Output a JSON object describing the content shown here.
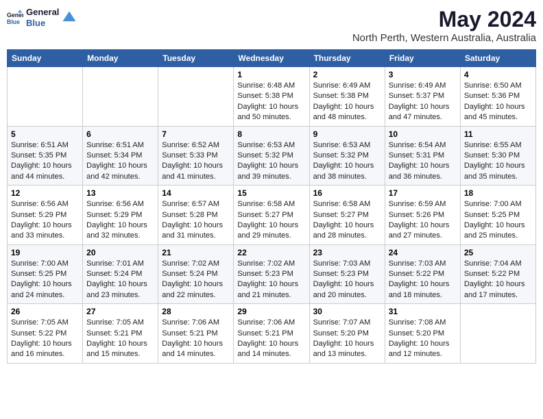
{
  "logo": {
    "line1": "General",
    "line2": "Blue"
  },
  "title": "May 2024",
  "subtitle": "North Perth, Western Australia, Australia",
  "days_header": [
    "Sunday",
    "Monday",
    "Tuesday",
    "Wednesday",
    "Thursday",
    "Friday",
    "Saturday"
  ],
  "weeks": [
    [
      {
        "day": "",
        "info": ""
      },
      {
        "day": "",
        "info": ""
      },
      {
        "day": "",
        "info": ""
      },
      {
        "day": "1",
        "info": "Sunrise: 6:48 AM\nSunset: 5:38 PM\nDaylight: 10 hours\nand 50 minutes."
      },
      {
        "day": "2",
        "info": "Sunrise: 6:49 AM\nSunset: 5:38 PM\nDaylight: 10 hours\nand 48 minutes."
      },
      {
        "day": "3",
        "info": "Sunrise: 6:49 AM\nSunset: 5:37 PM\nDaylight: 10 hours\nand 47 minutes."
      },
      {
        "day": "4",
        "info": "Sunrise: 6:50 AM\nSunset: 5:36 PM\nDaylight: 10 hours\nand 45 minutes."
      }
    ],
    [
      {
        "day": "5",
        "info": "Sunrise: 6:51 AM\nSunset: 5:35 PM\nDaylight: 10 hours\nand 44 minutes."
      },
      {
        "day": "6",
        "info": "Sunrise: 6:51 AM\nSunset: 5:34 PM\nDaylight: 10 hours\nand 42 minutes."
      },
      {
        "day": "7",
        "info": "Sunrise: 6:52 AM\nSunset: 5:33 PM\nDaylight: 10 hours\nand 41 minutes."
      },
      {
        "day": "8",
        "info": "Sunrise: 6:53 AM\nSunset: 5:32 PM\nDaylight: 10 hours\nand 39 minutes."
      },
      {
        "day": "9",
        "info": "Sunrise: 6:53 AM\nSunset: 5:32 PM\nDaylight: 10 hours\nand 38 minutes."
      },
      {
        "day": "10",
        "info": "Sunrise: 6:54 AM\nSunset: 5:31 PM\nDaylight: 10 hours\nand 36 minutes."
      },
      {
        "day": "11",
        "info": "Sunrise: 6:55 AM\nSunset: 5:30 PM\nDaylight: 10 hours\nand 35 minutes."
      }
    ],
    [
      {
        "day": "12",
        "info": "Sunrise: 6:56 AM\nSunset: 5:29 PM\nDaylight: 10 hours\nand 33 minutes."
      },
      {
        "day": "13",
        "info": "Sunrise: 6:56 AM\nSunset: 5:29 PM\nDaylight: 10 hours\nand 32 minutes."
      },
      {
        "day": "14",
        "info": "Sunrise: 6:57 AM\nSunset: 5:28 PM\nDaylight: 10 hours\nand 31 minutes."
      },
      {
        "day": "15",
        "info": "Sunrise: 6:58 AM\nSunset: 5:27 PM\nDaylight: 10 hours\nand 29 minutes."
      },
      {
        "day": "16",
        "info": "Sunrise: 6:58 AM\nSunset: 5:27 PM\nDaylight: 10 hours\nand 28 minutes."
      },
      {
        "day": "17",
        "info": "Sunrise: 6:59 AM\nSunset: 5:26 PM\nDaylight: 10 hours\nand 27 minutes."
      },
      {
        "day": "18",
        "info": "Sunrise: 7:00 AM\nSunset: 5:25 PM\nDaylight: 10 hours\nand 25 minutes."
      }
    ],
    [
      {
        "day": "19",
        "info": "Sunrise: 7:00 AM\nSunset: 5:25 PM\nDaylight: 10 hours\nand 24 minutes."
      },
      {
        "day": "20",
        "info": "Sunrise: 7:01 AM\nSunset: 5:24 PM\nDaylight: 10 hours\nand 23 minutes."
      },
      {
        "day": "21",
        "info": "Sunrise: 7:02 AM\nSunset: 5:24 PM\nDaylight: 10 hours\nand 22 minutes."
      },
      {
        "day": "22",
        "info": "Sunrise: 7:02 AM\nSunset: 5:23 PM\nDaylight: 10 hours\nand 21 minutes."
      },
      {
        "day": "23",
        "info": "Sunrise: 7:03 AM\nSunset: 5:23 PM\nDaylight: 10 hours\nand 20 minutes."
      },
      {
        "day": "24",
        "info": "Sunrise: 7:03 AM\nSunset: 5:22 PM\nDaylight: 10 hours\nand 18 minutes."
      },
      {
        "day": "25",
        "info": "Sunrise: 7:04 AM\nSunset: 5:22 PM\nDaylight: 10 hours\nand 17 minutes."
      }
    ],
    [
      {
        "day": "26",
        "info": "Sunrise: 7:05 AM\nSunset: 5:22 PM\nDaylight: 10 hours\nand 16 minutes."
      },
      {
        "day": "27",
        "info": "Sunrise: 7:05 AM\nSunset: 5:21 PM\nDaylight: 10 hours\nand 15 minutes."
      },
      {
        "day": "28",
        "info": "Sunrise: 7:06 AM\nSunset: 5:21 PM\nDaylight: 10 hours\nand 14 minutes."
      },
      {
        "day": "29",
        "info": "Sunrise: 7:06 AM\nSunset: 5:21 PM\nDaylight: 10 hours\nand 14 minutes."
      },
      {
        "day": "30",
        "info": "Sunrise: 7:07 AM\nSunset: 5:20 PM\nDaylight: 10 hours\nand 13 minutes."
      },
      {
        "day": "31",
        "info": "Sunrise: 7:08 AM\nSunset: 5:20 PM\nDaylight: 10 hours\nand 12 minutes."
      },
      {
        "day": "",
        "info": ""
      }
    ]
  ]
}
